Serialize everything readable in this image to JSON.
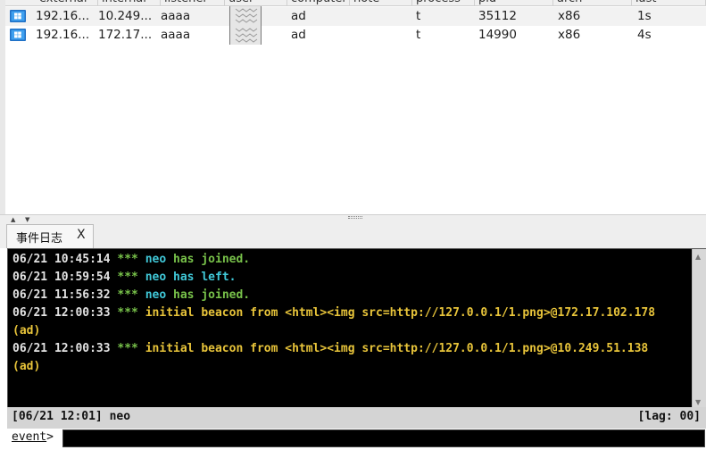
{
  "table": {
    "columns": [
      "external",
      "internal",
      "listener",
      "user",
      "computer",
      "note",
      "process",
      "pid",
      "arch",
      "last"
    ],
    "rows": [
      {
        "external": "192.16...",
        "internal": "10.249...",
        "listener": "aaaa",
        "computer": "ad",
        "note": "",
        "process": "t",
        "pid": "35112",
        "arch": "x86",
        "last": "1s",
        "os_icon": "windows-icon"
      },
      {
        "external": "192.16...",
        "internal": "172.17...",
        "listener": "aaaa",
        "computer": "ad",
        "note": "",
        "process": "t",
        "pid": "14990",
        "arch": "x86",
        "last": "4s",
        "os_icon": "windows-icon"
      }
    ]
  },
  "tab": {
    "label": "事件日志",
    "close": "X"
  },
  "log": [
    {
      "time": "06/21 10:45:14",
      "stars": "***",
      "user": "neo",
      "msg": "has joined.",
      "color": "green"
    },
    {
      "time": "06/21 10:59:54",
      "stars": "***",
      "user": "neo",
      "msg": "has left.",
      "color": "cyan"
    },
    {
      "time": "06/21 11:56:32",
      "stars": "***",
      "user": "neo",
      "msg": "has joined.",
      "color": "green"
    },
    {
      "time": "06/21 12:00:33",
      "stars": "***",
      "text": "initial beacon from <html><img src=http://127.0.0.1/1.png>@172.17.102.178",
      "wrap": "(ad)",
      "color": "yellow"
    },
    {
      "time": "06/21 12:00:33",
      "stars": "***",
      "text": "initial beacon from <html><img src=http://127.0.0.1/1.png>@10.249.51.138",
      "wrap": "(ad)",
      "color": "yellow"
    }
  ],
  "status": {
    "left": "[06/21 12:01] neo",
    "right": "[lag: 00]"
  },
  "command": {
    "prompt": "event",
    "suffix": ">",
    "value": ""
  },
  "colors": {
    "green": "#78c24a",
    "cyan": "#40c8d8",
    "yellow": "#e8c43a",
    "console_bg": "#000000"
  }
}
